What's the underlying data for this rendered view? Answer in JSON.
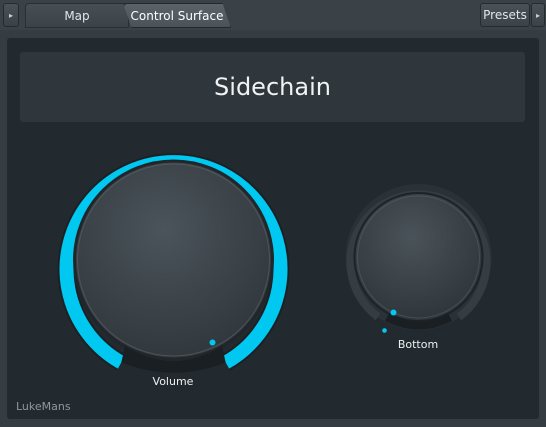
{
  "toolbar": {
    "menu_arrow_icon": "triangle-right-icon",
    "tabs": [
      {
        "label": "Map"
      },
      {
        "label": "Control Surface"
      }
    ],
    "presets_label": "Presets",
    "presets_arrow_icon": "triangle-right-icon"
  },
  "panel": {
    "title": "Sidechain",
    "author": "LukeMans"
  },
  "knobs": [
    {
      "label": "Volume",
      "value": 1.0,
      "accent": "#00c8f0"
    },
    {
      "label": "Bottom",
      "value": 0.0,
      "accent": "#00c8f0"
    }
  ],
  "colors": {
    "accent": "#00c8f0",
    "panel_bg": "#232a2f",
    "chrome_bg": "#363d42"
  }
}
